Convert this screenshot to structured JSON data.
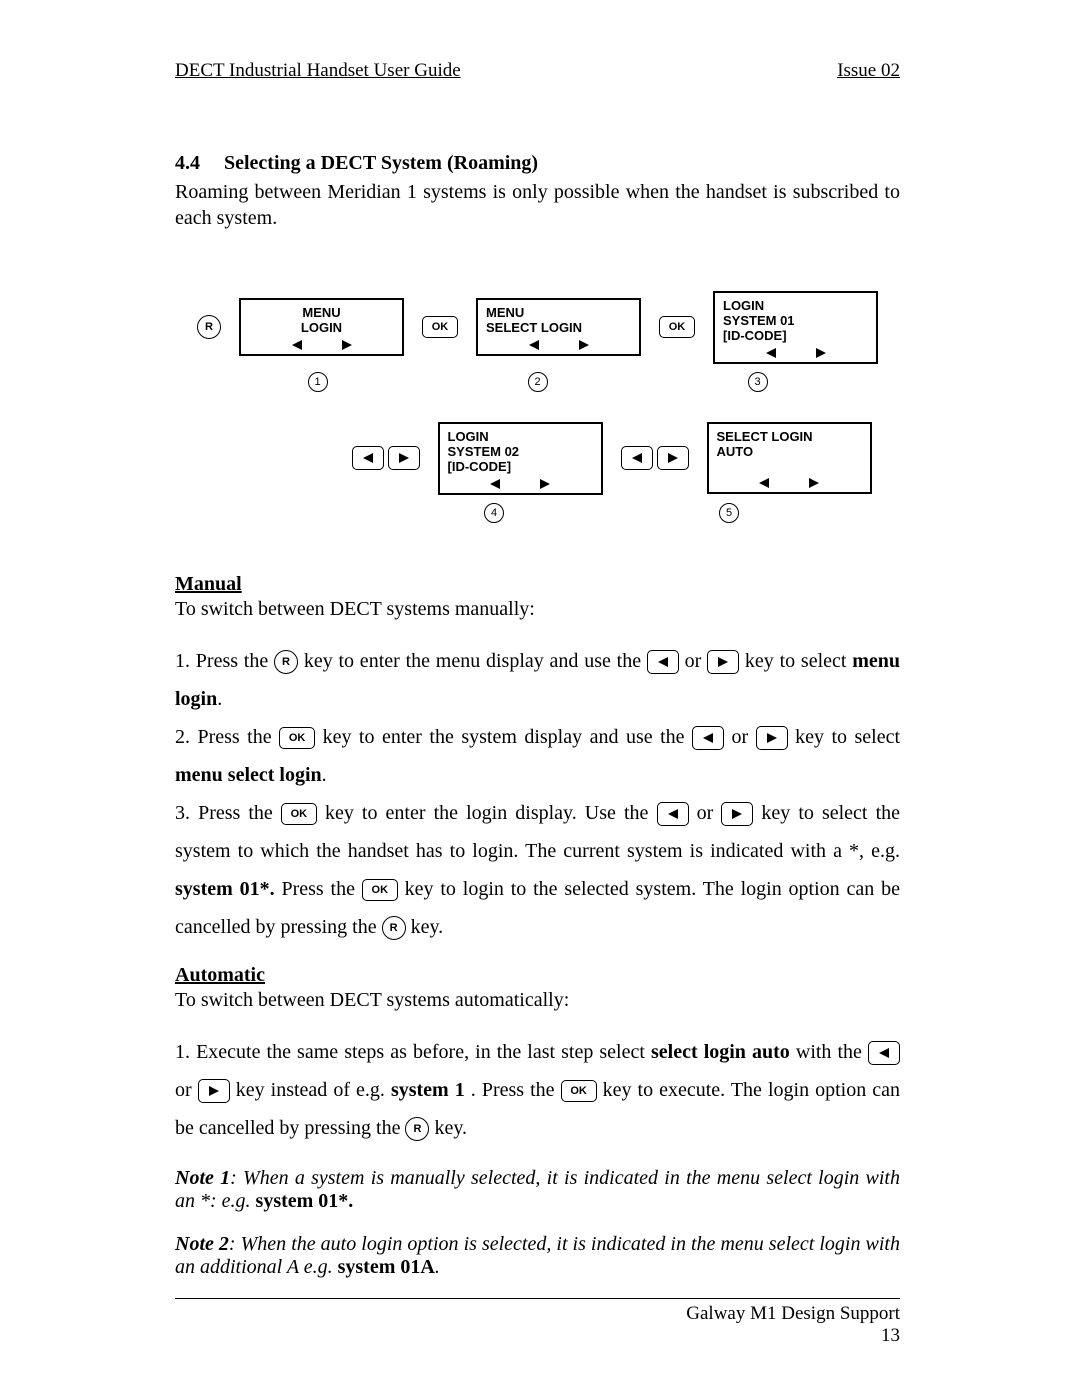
{
  "header": {
    "title": "DECT Industrial Handset User Guide",
    "issue": "Issue 02"
  },
  "section": {
    "number": "4.4",
    "title": "Selecting a DECT System (Roaming)",
    "intro": "Roaming between Meridian 1 systems is only possible when the handset is subscribed to each system."
  },
  "diagram": {
    "screens": [
      {
        "line1": "MENU",
        "line2": "LOGIN",
        "line3": ""
      },
      {
        "line1": "MENU",
        "line2": "SELECT LOGIN",
        "line3": ""
      },
      {
        "line1": "LOGIN",
        "line2": "SYSTEM 01",
        "line3": "[ID-CODE]"
      },
      {
        "line1": "LOGIN",
        "line2": "SYSTEM 02",
        "line3": "[ID-CODE]"
      },
      {
        "line1": "SELECT LOGIN",
        "line2": "AUTO",
        "line3": ""
      }
    ],
    "keys": {
      "r": "R",
      "ok": "OK"
    },
    "steps": [
      "1",
      "2",
      "3",
      "4",
      "5"
    ]
  },
  "manual": {
    "heading": "Manual",
    "intro": "To switch between DECT systems manually:",
    "step1_a": "1. Press the ",
    "step1_b": " key to enter the menu display and use the ",
    "step1_c": " or ",
    "step1_d": "  key to select ",
    "step1_bold": "menu login",
    "step1_end": ".",
    "step2_a": "2. Press the ",
    "step2_b": " key to enter the system display and use the ",
    "step2_c": " or ",
    "step2_d": "  key to select  ",
    "step2_bold": "menu select login",
    "step2_end": ".",
    "step3_a": "3. Press the ",
    "step3_b": " key to enter the login display. Use the ",
    "step3_c": " or ",
    "step3_d": "  key to select the system to which the handset has to login. The current system is indicated with a *, e.g. ",
    "step3_bold": "system 01*.",
    "step3_e": " Press the ",
    "step3_f": " key to login to the selected system. The login option can be cancelled by pressing the ",
    "step3_g": " key."
  },
  "automatic": {
    "heading": "Automatic",
    "intro": "To switch between DECT systems automatically:",
    "step1_a": "1. Execute the same steps as before, in the last step select ",
    "step1_bold1": "select login auto",
    "step1_b": " with the ",
    "step1_c": " or ",
    "step1_d": "  key instead of e.g. ",
    "step1_bold2": "system 1",
    "step1_e": ". Press the ",
    "step1_f": " key to execute. The login option can be cancelled by pressing the ",
    "step1_g": " key."
  },
  "notes": {
    "note1_label": "Note 1",
    "note1_text": ": When a system is manually selected, it is indicated in the menu select login with an *: e.g. ",
    "note1_bold": "system 01*.",
    "note2_label": "Note 2",
    "note2_text": ": When the auto login option is selected, it is indicated in the menu select login with an additional A e.g. ",
    "note2_bold": "system 01A",
    "note2_end": "."
  },
  "footer": {
    "org": "Galway M1 Design Support",
    "page": "13"
  }
}
